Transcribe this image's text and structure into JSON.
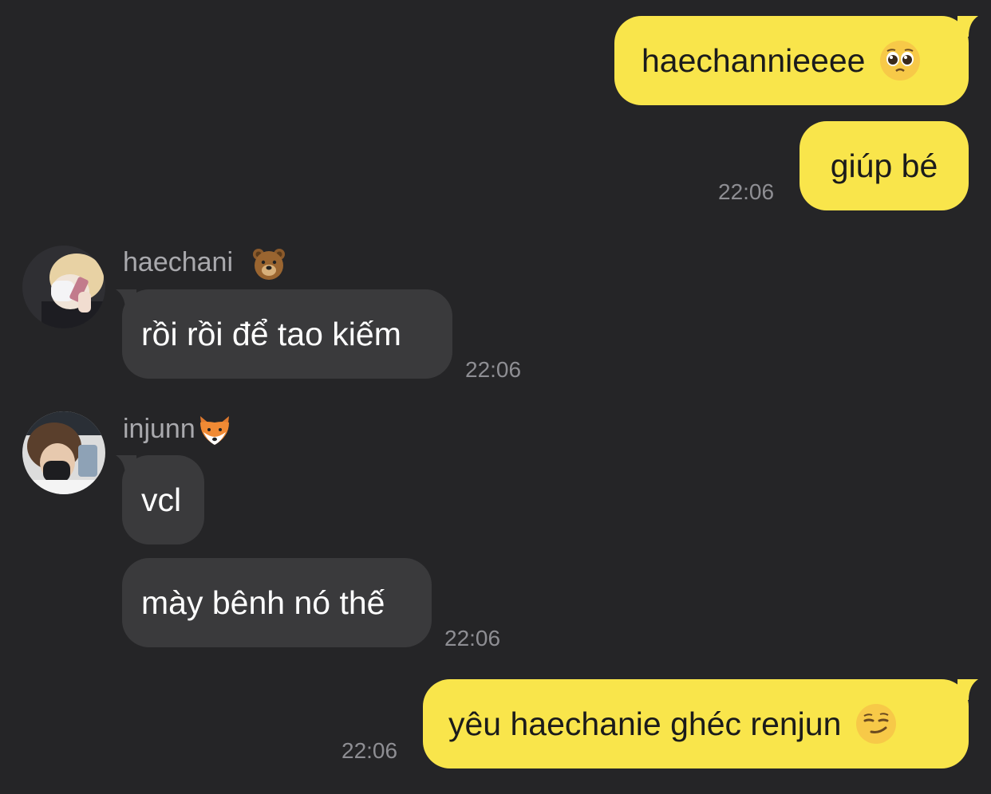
{
  "conversation": {
    "messages": [
      {
        "id": "m1",
        "direction": "outgoing",
        "text": "haechannieeee",
        "emoji": "pleading-face-icon"
      },
      {
        "id": "m2",
        "direction": "outgoing",
        "text": "giúp bé",
        "time": "22:06"
      },
      {
        "id": "m3",
        "direction": "incoming",
        "sender": "haechani",
        "sender_emoji": "bear-face-icon",
        "text": "rồi rồi để tao kiếm",
        "time": "22:06"
      },
      {
        "id": "m4",
        "direction": "incoming",
        "sender": "injunn",
        "sender_emoji": "fox-face-icon",
        "text": "vcl"
      },
      {
        "id": "m5",
        "direction": "incoming",
        "sender": "injunn",
        "text": "mày bênh nó thế",
        "time": "22:06"
      },
      {
        "id": "m6",
        "direction": "outgoing",
        "text": "yêu haechanie ghéc renjun",
        "emoji": "smirking-face-icon",
        "time": "22:06"
      }
    ]
  },
  "colors": {
    "background": "#252527",
    "outgoing_bubble": "#F9E54B",
    "incoming_bubble": "#3A3A3C",
    "timestamp": "#8E8E93",
    "sender_name": "#A9A9AD"
  }
}
